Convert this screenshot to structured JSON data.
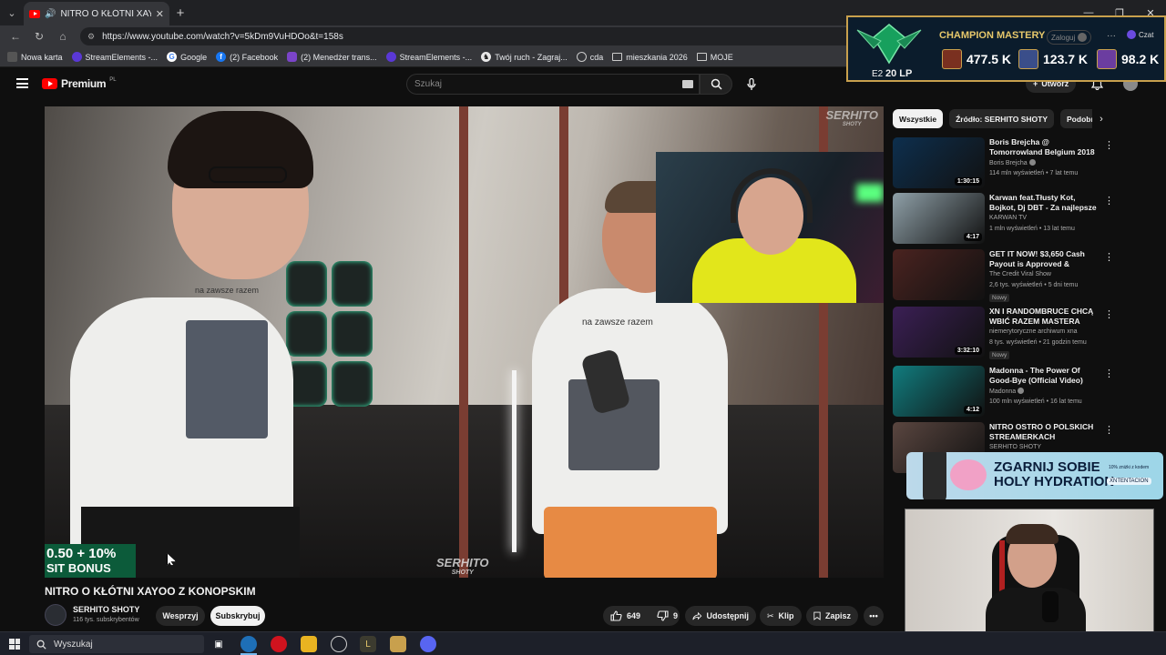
{
  "browser": {
    "tab_title": "NITRO O KŁÓTNI XAYOO Z KO",
    "url": "https://www.youtube.com/watch?v=5kDm9VuHDOo&t=158s",
    "bookmarks": [
      {
        "label": "Nowa karta"
      },
      {
        "label": "StreamElements -..."
      },
      {
        "label": "Google"
      },
      {
        "label": "(2) Facebook"
      },
      {
        "label": "(2) Menedżer trans..."
      },
      {
        "label": "StreamElements -..."
      },
      {
        "label": "Twój ruch - Zagraj..."
      },
      {
        "label": "cda"
      },
      {
        "label": "mieszkania 2026"
      },
      {
        "label": "MOJE"
      }
    ]
  },
  "header": {
    "logo_text": "Premium",
    "logo_country": "PL",
    "search_placeholder": "Szukaj",
    "create_label": "Utwórz"
  },
  "video": {
    "watermark": "SERHITO",
    "watermark_sub": "SHOTY",
    "shirt_text": "na zawsze razem",
    "promo_line1": "0.50 + 10%",
    "promo_line2": "SIT BONUS",
    "title": "NITRO O KŁÓTNI XAYOO Z KONOPSKIM",
    "channel": "SERHITO SHOTY",
    "subscribers": "116 tys. subskrybentów",
    "support_label": "Wesprzyj",
    "subscribe_label": "Subskrybuj",
    "likes": "649",
    "dislikes": "9",
    "share_label": "Udostępnij",
    "clip_label": "Klip",
    "save_label": "Zapisz"
  },
  "sidebar": {
    "chips": [
      "Wszystkie",
      "Źródło: SERHITO SHOTY",
      "Podobne"
    ],
    "recommendations": [
      {
        "title": "Boris Brejcha @ Tomorrowland Belgium 2018",
        "channel": "Boris Brejcha",
        "meta": "114 mln wyświetleń • 7 lat temu",
        "duration": "1:30:15",
        "badge": "",
        "color": "#0d2f4e"
      },
      {
        "title": "Karwan feat.Tłusty Kot, Bojkot, Dj DBT - Za najlepsze akcje ...",
        "channel": "KARWAN TV",
        "meta": "1 mln wyświetleń • 13 lat temu",
        "duration": "4:17",
        "badge": "",
        "color": "#8fa0a8"
      },
      {
        "title": "GET IT NOW! $3,650 Cash Payout is Approved & Coming...",
        "channel": "The Credit Viral Show",
        "meta": "2,6 tys. wyświetleń • 5 dni temu",
        "duration": "",
        "badge": "Nowy",
        "color": "#4a2320"
      },
      {
        "title": "XN I RANDOMBRUCE CHCĄ WBIĆ RAZEM MASTERA (coac...",
        "channel": "niemerytoryczne archiwum xna",
        "meta": "8 tys. wyświetleń • 21 godzin temu",
        "duration": "3:32:10",
        "badge": "Nowy",
        "color": "#3b1f55"
      },
      {
        "title": "Madonna - The Power Of Good-Bye (Official Video)",
        "channel": "Madonna",
        "meta": "100 mln wyświetleń • 16 lat temu",
        "duration": "4:12",
        "badge": "",
        "color": "#117c7e"
      },
      {
        "title": "NITRO OSTRO O POLSKICH STREAMERKACH",
        "channel": "SERHITO SHOTY",
        "meta": "",
        "duration": "",
        "badge": "",
        "color": "#5a4640"
      }
    ]
  },
  "overlay_lol": {
    "title": "CHAMPION MASTERY",
    "rank_tier": "E2",
    "rank_lp": "20 LP",
    "login_label": "Zaloguj",
    "chat_label": "Czat",
    "champions": [
      {
        "points": "477.5 K",
        "color": "#7a3020"
      },
      {
        "points": "123.7 K",
        "color": "#3a4e8a"
      },
      {
        "points": "98.2 K",
        "color": "#6b3da0"
      }
    ]
  },
  "overlay_ad": {
    "headline1": "ZGARNIJ SOBIE",
    "headline2": "HOLY HYDRATION",
    "code_label": "XNTENTACION",
    "small_text": "10% zniżki z kodem"
  },
  "taskbar": {
    "search_label": "Wyszukaj"
  }
}
